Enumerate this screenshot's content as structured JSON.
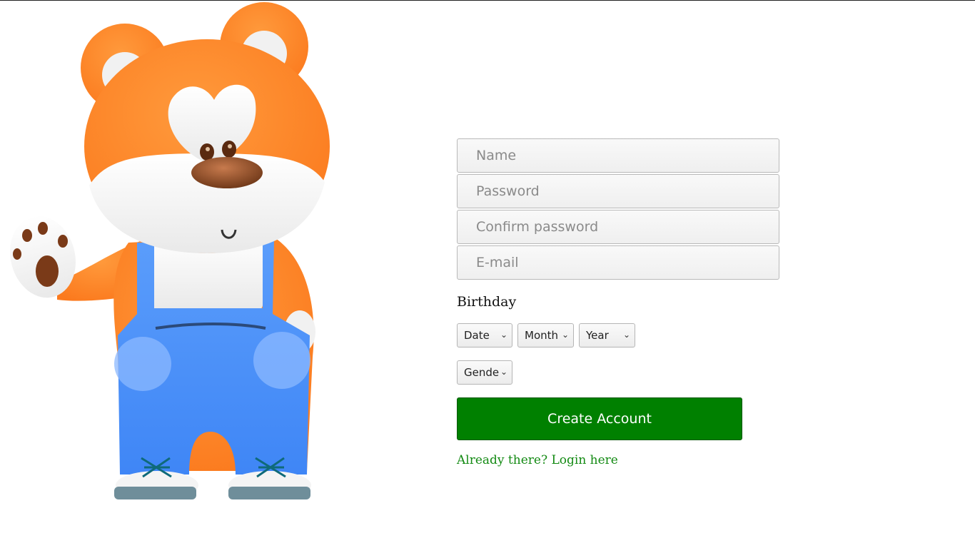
{
  "form": {
    "name_placeholder": "Name",
    "password_placeholder": "Password",
    "confirm_placeholder": "Confirm password",
    "email_placeholder": "E-mail",
    "birthday_label": "Birthday",
    "date_select": "Date",
    "month_select": "Month",
    "year_select": "Year",
    "gender_select": "Gender",
    "create_button": "Create Account",
    "login_link": "Already there? Login here"
  },
  "colors": {
    "button_green": "#008000",
    "link_green": "#138a13",
    "bear_orange": "#fd7f28",
    "overalls_blue": "#4f94fb"
  },
  "icons": {
    "select_arrow": "chevron-down-icon"
  }
}
